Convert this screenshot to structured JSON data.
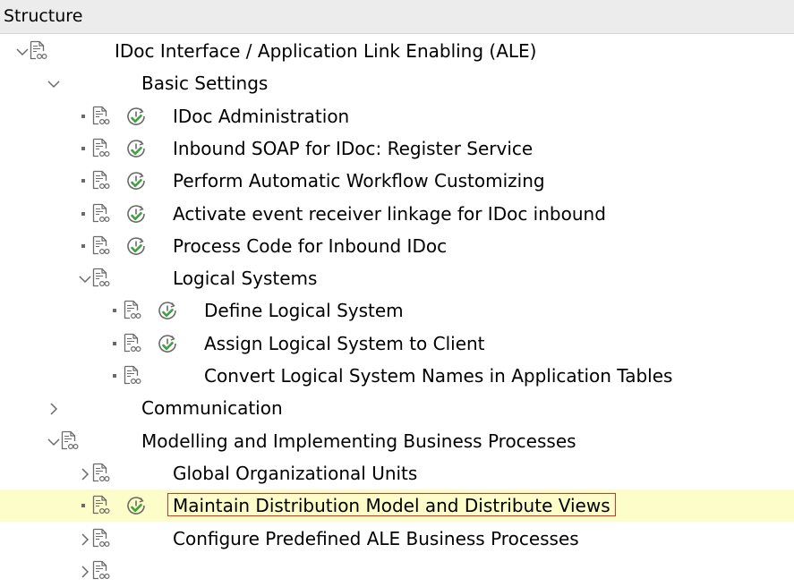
{
  "header": {
    "title": "Structure"
  },
  "icons": {
    "expanded": "chevron-down-icon",
    "collapsed": "chevron-right-icon",
    "leaf": "bullet-icon",
    "node": "documentation-icon",
    "execute": "execute-activity-icon"
  },
  "colors": {
    "selection_background": "#fdfdc9",
    "focus_border": "#d9322d",
    "execute_icon_green": "#3fa03f",
    "icon_gray": "#6a6a6a"
  },
  "tree": [
    {
      "label": "IDoc Interface / Application Link Enabling (ALE)",
      "level": 0,
      "toggle": "expanded",
      "doc": true,
      "exec": false
    },
    {
      "label": "Basic Settings",
      "level": 1,
      "toggle": "expanded",
      "doc": false,
      "exec": false
    },
    {
      "label": "IDoc Administration",
      "level": 2,
      "toggle": "leaf",
      "doc": true,
      "exec": true
    },
    {
      "label": "Inbound SOAP for IDoc: Register Service",
      "level": 2,
      "toggle": "leaf",
      "doc": true,
      "exec": true
    },
    {
      "label": "Perform Automatic Workflow Customizing",
      "level": 2,
      "toggle": "leaf",
      "doc": true,
      "exec": true
    },
    {
      "label": "Activate event receiver linkage for IDoc inbound",
      "level": 2,
      "toggle": "leaf",
      "doc": true,
      "exec": true
    },
    {
      "label": "Process Code for Inbound IDoc",
      "level": 2,
      "toggle": "leaf",
      "doc": true,
      "exec": true
    },
    {
      "label": "Logical Systems",
      "level": 2,
      "toggle": "expanded",
      "doc": true,
      "exec": false
    },
    {
      "label": "Define Logical System",
      "level": 3,
      "toggle": "leaf",
      "doc": true,
      "exec": true
    },
    {
      "label": "Assign Logical System to Client",
      "level": 3,
      "toggle": "leaf",
      "doc": true,
      "exec": true
    },
    {
      "label": "Convert Logical System Names in Application Tables",
      "level": 3,
      "toggle": "leaf",
      "doc": true,
      "exec": false
    },
    {
      "label": "Communication",
      "level": 1,
      "toggle": "collapsed",
      "doc": false,
      "exec": false
    },
    {
      "label": "Modelling and Implementing Business Processes",
      "level": 1,
      "toggle": "expanded",
      "doc": true,
      "exec": false
    },
    {
      "label": "Global Organizational Units",
      "level": 2,
      "toggle": "collapsed",
      "doc": true,
      "exec": false
    },
    {
      "label": "Maintain Distribution Model and Distribute Views",
      "level": 2,
      "toggle": "leaf",
      "doc": true,
      "exec": true,
      "selected": true
    },
    {
      "label": "Configure Predefined ALE Business Processes",
      "level": 2,
      "toggle": "collapsed",
      "doc": true,
      "exec": false
    },
    {
      "label": "",
      "level": 2,
      "toggle": "collapsed",
      "doc": true,
      "exec": false
    }
  ]
}
